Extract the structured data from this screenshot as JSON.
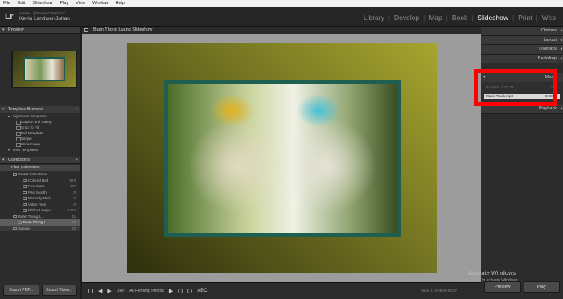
{
  "menubar": [
    "File",
    "Edit",
    "Slideshow",
    "Play",
    "View",
    "Window",
    "Help"
  ],
  "identity": {
    "logo": "Lr",
    "catalog": "Adobe Lightroom Classic CC",
    "user": "Kevin Landwer-Johan"
  },
  "modules": [
    {
      "label": "Library",
      "active": false
    },
    {
      "label": "Develop",
      "active": false
    },
    {
      "label": "Map",
      "active": false
    },
    {
      "label": "Book",
      "active": false
    },
    {
      "label": "Slideshow",
      "active": true
    },
    {
      "label": "Print",
      "active": false
    },
    {
      "label": "Web",
      "active": false
    }
  ],
  "left": {
    "preview_title": "Preview",
    "template_title": "Template Browser",
    "templates": [
      {
        "label": "Lightroom Templates",
        "folder": true
      },
      {
        "label": "Caption and Rating",
        "folder": false
      },
      {
        "label": "Crop To Fill",
        "folder": false
      },
      {
        "label": "Exif Metadata",
        "folder": false
      },
      {
        "label": "Simple",
        "folder": false
      },
      {
        "label": "Widescreen",
        "folder": false
      },
      {
        "label": "User Templates",
        "folder": true
      }
    ],
    "collections_title": "Collections",
    "collections": [
      {
        "label": "Filter Collections",
        "count": "",
        "indent": 8,
        "header": true
      },
      {
        "label": "Smart Collections",
        "count": "",
        "indent": 16
      },
      {
        "label": "Colored Red",
        "count": "673",
        "indent": 28
      },
      {
        "label": "Five Stars",
        "count": "487",
        "indent": 28
      },
      {
        "label": "Past Month",
        "count": "0",
        "indent": 28
      },
      {
        "label": "Recently Mod...",
        "count": "0",
        "indent": 28
      },
      {
        "label": "Video Files",
        "count": "0",
        "indent": 28
      },
      {
        "label": "Without Keyw...",
        "count": "4284",
        "indent": 28
      },
      {
        "label": "Baan Thong L...",
        "count": "41",
        "indent": 16
      },
      {
        "label": "Baan Thong L...",
        "count": "48",
        "indent": 22,
        "selected": true
      },
      {
        "label": "Salone",
        "count": "32",
        "indent": 16
      }
    ],
    "export_pdf": "Export PDF...",
    "export_video": "Export Video..."
  },
  "center": {
    "title": "Baan Thong Luang Slideshow",
    "toolbar_use": "Use:",
    "toolbar_source": "All Filmstrip Photos",
    "toolbar_abc": "ABC",
    "toolbar_right": "Slide 1 of 48   00:03:07"
  },
  "right": {
    "sections": [
      "Options",
      "Layout",
      "Overlays",
      "Backdrop"
    ],
    "music_title": "Music",
    "duration_label": "Duration:",
    "duration_value": "0:03:27",
    "track_name": "Music Track.mp3",
    "track_time": "0:03:27",
    "playback": "Playback",
    "preview_btn": "Preview",
    "play_btn": "Play"
  },
  "watermark": {
    "title": "Activate Windows",
    "subtitle": "Go to Settings to activate Windows."
  },
  "colors": {
    "highlight": "#ff0000"
  }
}
